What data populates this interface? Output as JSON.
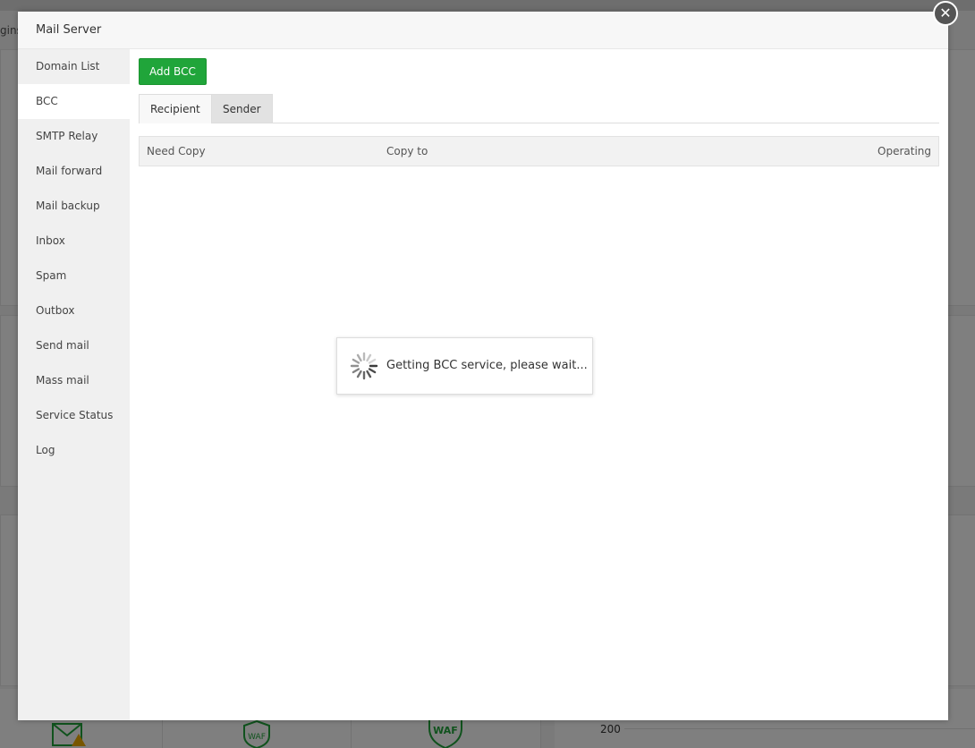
{
  "background": {
    "notice_text": "gins",
    "axis_tick": "200",
    "card_labels": [
      "WAF",
      "WAF"
    ]
  },
  "modal": {
    "title": "Mail Server",
    "close_symbol": "✕"
  },
  "sidebar": {
    "items": [
      {
        "label": "Domain List"
      },
      {
        "label": "BCC"
      },
      {
        "label": "SMTP Relay"
      },
      {
        "label": "Mail forward"
      },
      {
        "label": "Mail backup"
      },
      {
        "label": "Inbox"
      },
      {
        "label": "Spam"
      },
      {
        "label": "Outbox"
      },
      {
        "label": "Send mail"
      },
      {
        "label": "Mass mail"
      },
      {
        "label": "Service Status"
      },
      {
        "label": "Log"
      }
    ],
    "active_index": 1
  },
  "toolbar": {
    "add_label": "Add BCC"
  },
  "tabs": [
    {
      "label": "Recipient",
      "active": true
    },
    {
      "label": "Sender",
      "active": false
    }
  ],
  "table": {
    "columns": [
      "Need Copy",
      "Copy to",
      "Operating"
    ],
    "rows": []
  },
  "loading": {
    "message": "Getting BCC service, please wait..."
  },
  "colors": {
    "accent": "#20a53a",
    "overlay": "rgba(0,0,0,0.5)",
    "close_button": "#555555"
  },
  "icons": {
    "close": "close-icon",
    "spinner": "loading-spinner-icon",
    "mail_warning": "mail-warning-icon",
    "waf": "waf-shield-icon"
  }
}
